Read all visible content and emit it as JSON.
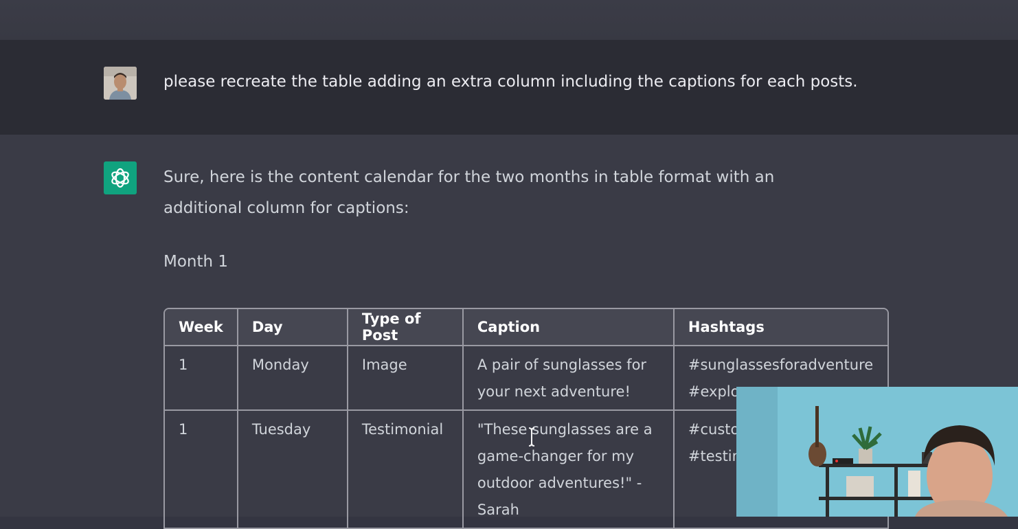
{
  "conversation": {
    "user_message": "please recreate the table adding an extra column including the captions for each posts.",
    "assistant_intro": "Sure, here is the content calendar for the two months in table format with an additional column for captions:",
    "month_heading": "Month 1"
  },
  "table": {
    "headers": {
      "week": "Week",
      "day": "Day",
      "type": "Type of Post",
      "caption": "Caption",
      "hashtags": "Hashtags"
    },
    "rows": [
      {
        "week": "1",
        "day": "Monday",
        "type": "Image",
        "caption": "A pair of sunglasses for your next adventure!",
        "hashtags": "#sunglassesforadventure #explore"
      },
      {
        "week": "1",
        "day": "Tuesday",
        "type": "Testimonial",
        "caption": "\"These sunglasses are a game-changer for my outdoor adventures!\" - Sarah",
        "hashtags": "#custom #happy #testim"
      }
    ]
  },
  "icons": {
    "assistant_avatar": "openai-logo-icon",
    "user_avatar": "user-photo-avatar",
    "cursor": "text-cursor-icon"
  },
  "colors": {
    "assistant_avatar_bg": "#10a37f",
    "page_bg": "#343541",
    "user_row_bg": "#2b2c34"
  }
}
